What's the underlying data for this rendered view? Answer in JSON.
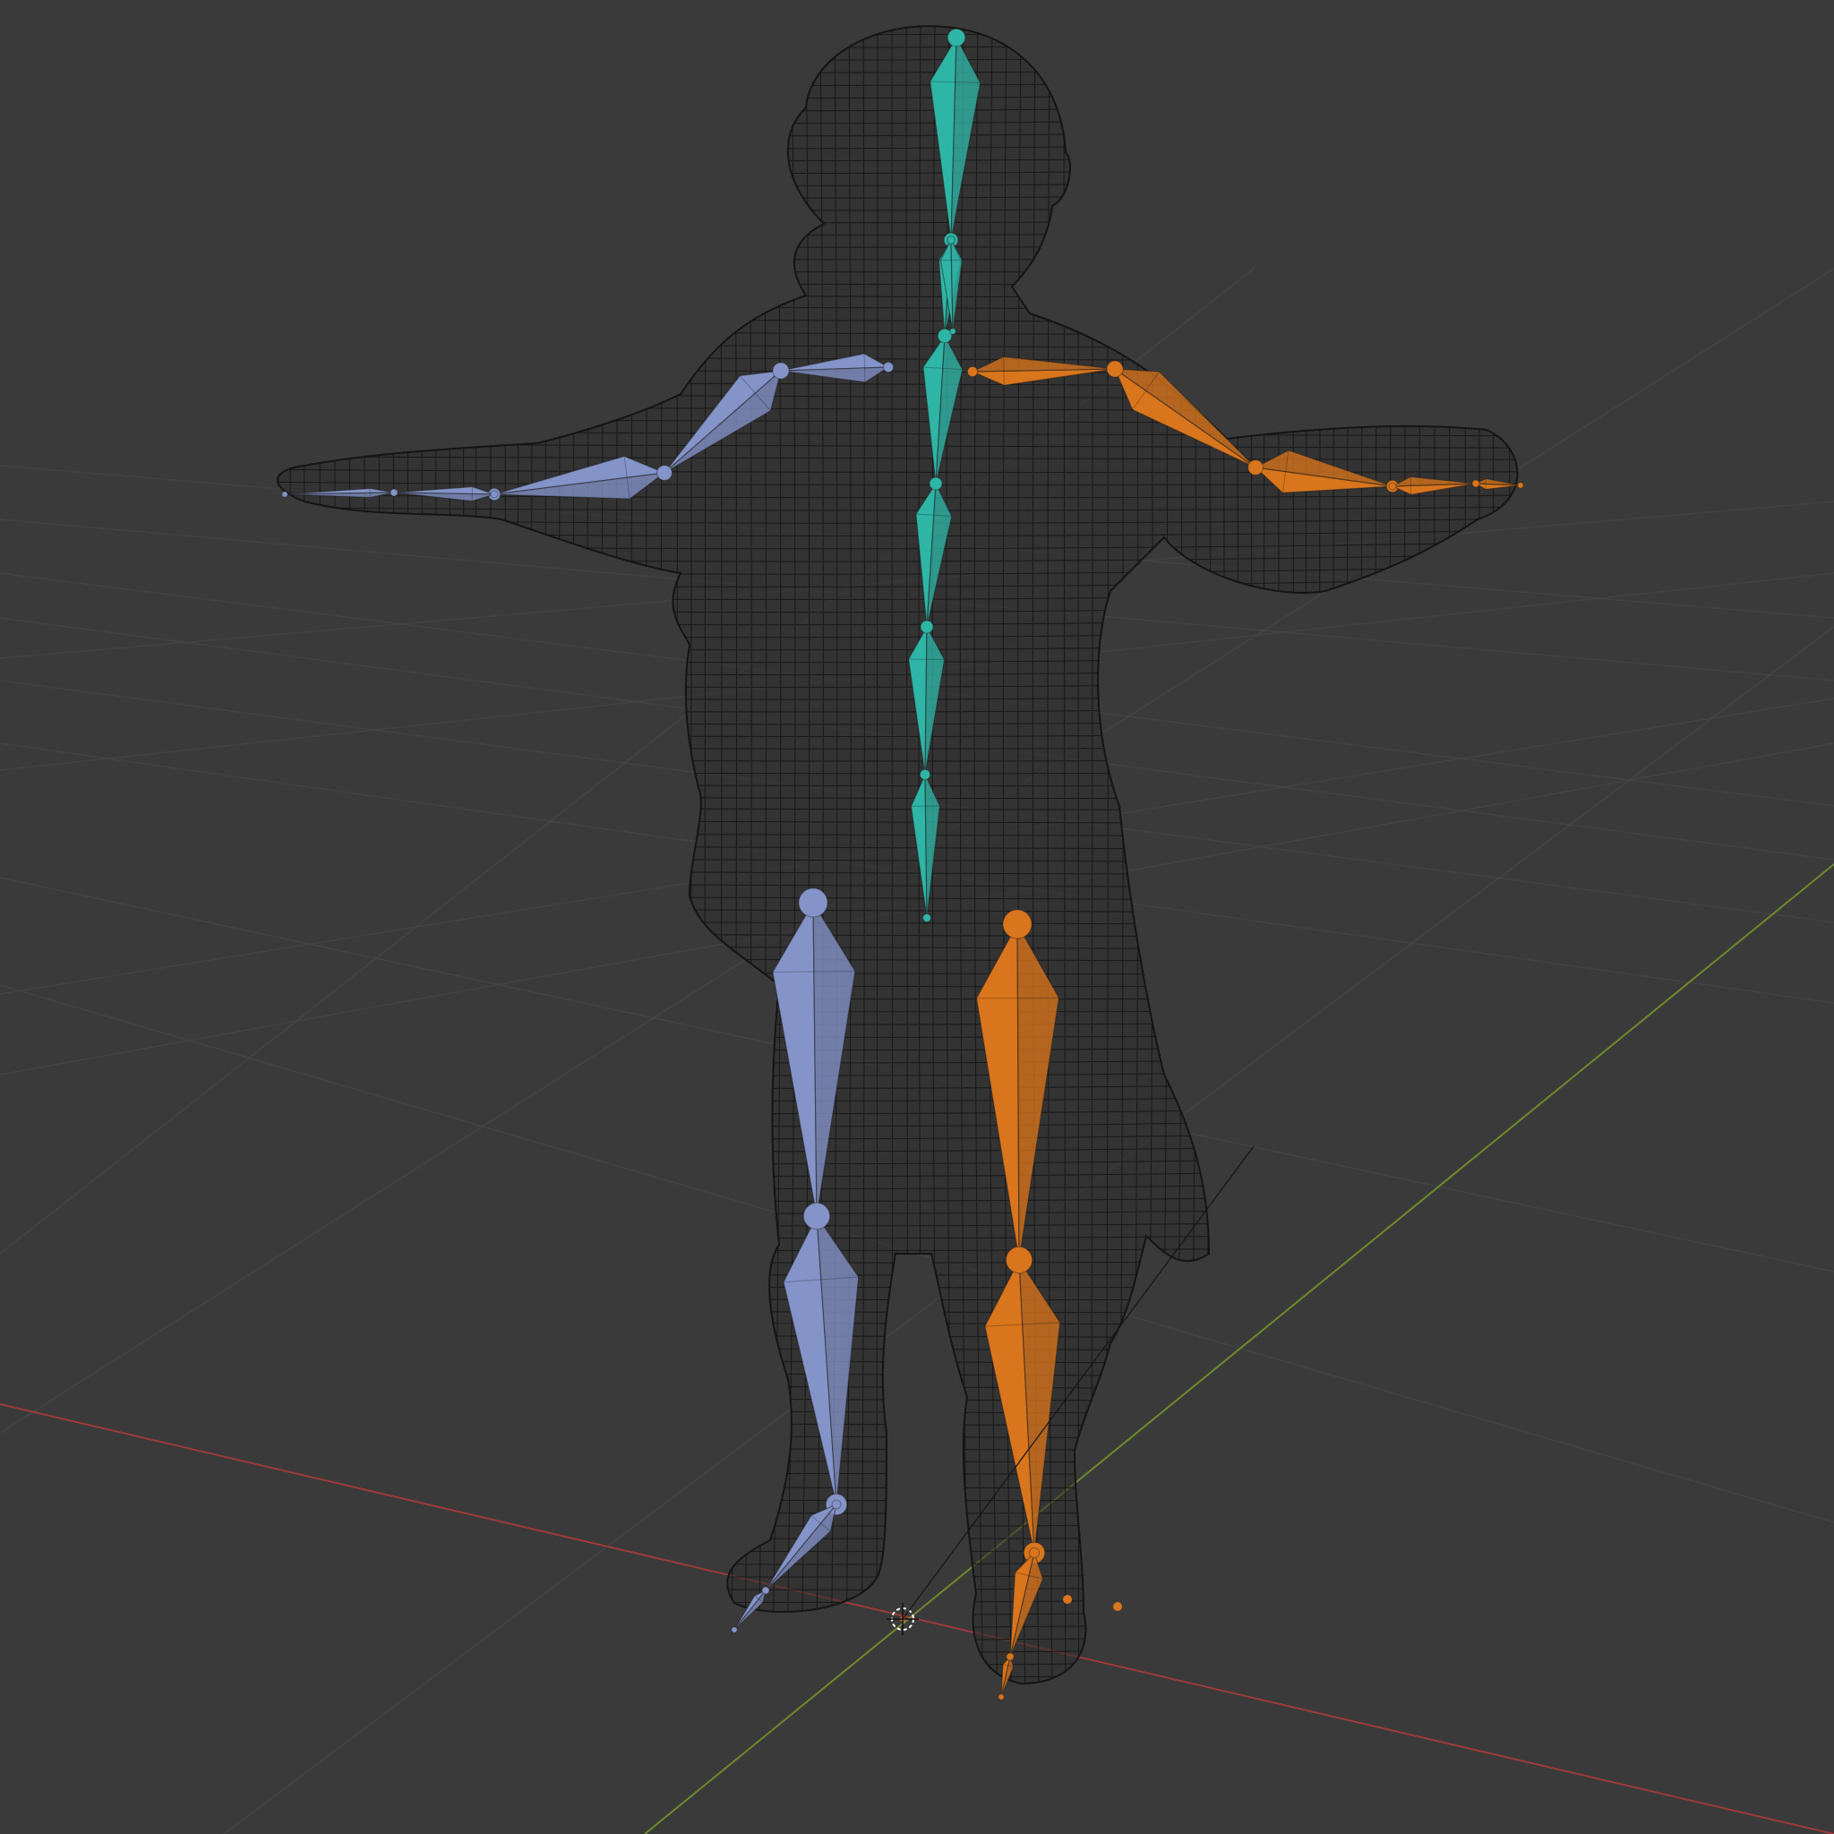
{
  "app": "3D viewport",
  "viewport": {
    "background": "#3a3a3a",
    "grid_color": "#4a4a4a",
    "axis_x_color": "#9c3b3b",
    "axis_y_color": "#6f8a2c",
    "mesh_wire_color": "#141414",
    "display_mode": "wireframe"
  },
  "armature": {
    "bone_colors": {
      "center": "#2fb5a6",
      "left": "#8494c9",
      "right": "#d9751c"
    },
    "bone_groups": {
      "spine": [
        "head",
        "neck",
        "chest",
        "spine-upper",
        "spine-mid",
        "spine-lower",
        "hips"
      ],
      "left_arm": [
        "shoulder",
        "upper-arm",
        "forearm",
        "hand",
        "fingers"
      ],
      "right_arm": [
        "shoulder",
        "upper-arm",
        "forearm",
        "hand",
        "fingers"
      ],
      "left_leg": [
        "thigh",
        "shin",
        "foot",
        "toe"
      ],
      "right_leg": [
        "thigh",
        "shin",
        "foot",
        "toe"
      ]
    }
  },
  "widgets": {
    "origin": "3d-cursor-icon"
  }
}
